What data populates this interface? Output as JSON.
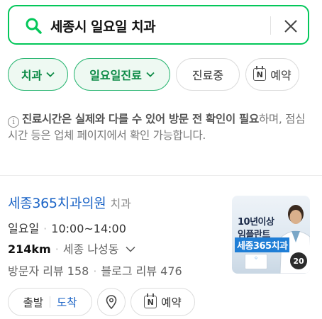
{
  "search": {
    "query": "세종시 일요일 치과",
    "icons": {
      "search": "search-icon",
      "clear": "close-icon"
    },
    "accent_color": "#03c75a"
  },
  "filters": [
    {
      "label": "치과",
      "active": true,
      "icon": "chevron-down-icon"
    },
    {
      "label": "일요일진료",
      "active": true,
      "icon": "chevron-down-icon"
    },
    {
      "label": "진료중",
      "active": false
    },
    {
      "label": "예약",
      "active": false,
      "icon": "naver-booking-icon"
    }
  ],
  "notice": {
    "icon": "info-icon",
    "bold_text": "진료시간은 실제와 다를 수 있어 방문 전 확인이 필요",
    "rest_text": "하며, 점심시간 등은 업체 페이지에서 확인 가능합니다."
  },
  "place": {
    "name": "세종365치과의원",
    "category": "치과",
    "day": "일요일",
    "hours": "10:00~14:00",
    "distance": "214km",
    "area": "세종 나성동",
    "visitor_reviews": "방문자 리뷰 158",
    "blog_reviews": "블로그 리뷰 476",
    "thumbnail": {
      "line1": "10년이상",
      "line2": "임플란트",
      "line3": "세종365치과",
      "photo_count": "20"
    },
    "name_color": "#1a63c6"
  },
  "actions": {
    "depart": "출발",
    "arrive": "도착",
    "map_icon": "map-pin-icon",
    "booking": "예약"
  }
}
